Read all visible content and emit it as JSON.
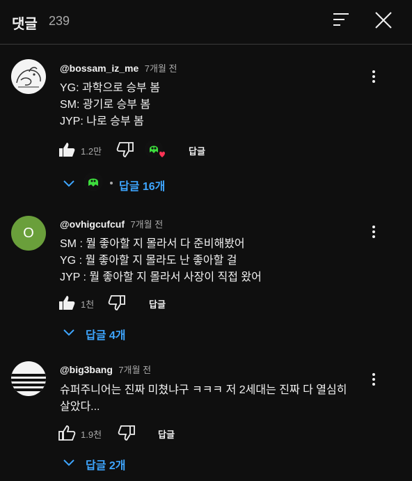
{
  "header": {
    "title": "댓글",
    "count": "239"
  },
  "comments": [
    {
      "author": "@bossam_iz_me",
      "time": "7개월 전",
      "lines": [
        "YG: 과학으로 승부 봄",
        "SM: 광기로 승부 봄",
        "JYP: 나로 승부 봄"
      ],
      "likes": "1.2만",
      "reply_label": "답글",
      "replies_label": "답글 16개"
    },
    {
      "author": "@ovhigcufcuf",
      "avatar_letter": "O",
      "time": "7개월 전",
      "lines": [
        "SM : 뭘 좋아할 지 몰라서 다 준비해봤어",
        "YG : 뭘 좋아할 지 몰라도 난 좋아할 걸",
        "JYP : 뭘 좋아할 지 몰라서 사장이 직접 왔어"
      ],
      "likes": "1천",
      "reply_label": "답글",
      "replies_label": "답글 4개"
    },
    {
      "author": "@big3bang",
      "time": "7개월 전",
      "text": "슈퍼주니어는 진짜 미쳤냐구 ㅋㅋㅋ 저 2세대는 진짜 다 열심히 살았다...",
      "likes": "1.9천",
      "reply_label": "답글",
      "replies_label": "답글 2개"
    }
  ],
  "colors": {
    "background": "#0f0f0f",
    "link": "#3ea6ff",
    "muted": "#aaaaaa",
    "avatar_green": "#6a9f3b",
    "heart": "#ff3355"
  }
}
